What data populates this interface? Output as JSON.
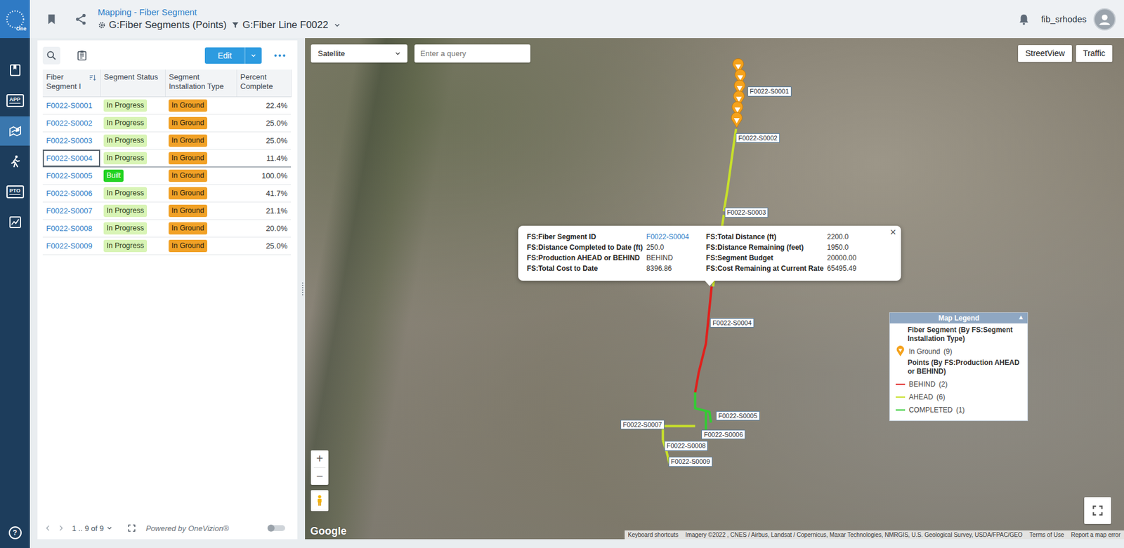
{
  "app": {
    "logo": "One",
    "help": "?"
  },
  "nav": [
    {
      "kind": "book",
      "label": "",
      "selected": false
    },
    {
      "kind": "badge",
      "label": "APP",
      "selected": false
    },
    {
      "kind": "route",
      "label": "",
      "selected": true
    },
    {
      "kind": "walker",
      "label": "",
      "selected": false
    },
    {
      "kind": "badge",
      "label": "PTO",
      "selected": false
    },
    {
      "kind": "chart",
      "label": "",
      "selected": false
    }
  ],
  "header": {
    "title": "Mapping - Fiber Segment",
    "view": "G:Fiber Segments (Points)",
    "filter": "G:Fiber Line F0022",
    "user": "fib_srhodes"
  },
  "toolbar": {
    "edit": "Edit"
  },
  "table": {
    "columns": [
      "Fiber Segment I",
      "Segment Status",
      "Segment Installation Type",
      "Percent Complete"
    ],
    "rows": [
      {
        "id": "F0022-S0001",
        "status": "In Progress",
        "color": "#d8f4b5",
        "type": "In Ground",
        "percent": "22.4%",
        "selected": false
      },
      {
        "id": "F0022-S0002",
        "status": "In Progress",
        "color": "#d8f4b5",
        "type": "In Ground",
        "percent": "25.0%",
        "selected": false
      },
      {
        "id": "F0022-S0003",
        "status": "In Progress",
        "color": "#d8f4b5",
        "type": "In Ground",
        "percent": "25.0%",
        "selected": false
      },
      {
        "id": "F0022-S0004",
        "status": "In Progress",
        "color": "#d8f4b5",
        "type": "In Ground",
        "percent": "11.4%",
        "selected": true
      },
      {
        "id": "F0022-S0005",
        "status": "Built",
        "color": "#22d322",
        "type": "In Ground",
        "percent": "100.0%",
        "selected": false
      },
      {
        "id": "F0022-S0006",
        "status": "In Progress",
        "color": "#d8f4b5",
        "type": "In Ground",
        "percent": "41.7%",
        "selected": false
      },
      {
        "id": "F0022-S0007",
        "status": "In Progress",
        "color": "#d8f4b5",
        "type": "In Ground",
        "percent": "21.1%",
        "selected": false
      },
      {
        "id": "F0022-S0008",
        "status": "In Progress",
        "color": "#d8f4b5",
        "type": "In Ground",
        "percent": "20.0%",
        "selected": false
      },
      {
        "id": "F0022-S0009",
        "status": "In Progress",
        "color": "#d8f4b5",
        "type": "In Ground",
        "percent": "25.0%",
        "selected": false
      }
    ]
  },
  "footer": {
    "range": "1 .. 9 of 9",
    "powered": "Powered by OneVizion®"
  },
  "map": {
    "type": "Satellite",
    "query_placeholder": "Enter a query",
    "buttons": [
      "StreetView",
      "Traffic"
    ],
    "zoom_in": "+",
    "zoom_out": "−",
    "google": "Google",
    "attribution": [
      "Keyboard shortcuts",
      "Imagery ©2022 , CNES / Airbus, Landsat / Copernicus, Maxar Technologies, NMRGIS, U.S. Geological Survey, USDA/FPAC/GEO",
      "Terms of Use",
      "Report a map error"
    ]
  },
  "segments": [
    {
      "label": "F0022-S0001",
      "kind": "pins",
      "color": "#f5a21c"
    },
    {
      "label": "F0022-S0002",
      "kind": "line",
      "color": "#c8e02a"
    },
    {
      "label": "F0022-S0003",
      "kind": "line",
      "color": "#c8e02a"
    },
    {
      "label": "F0022-S0004",
      "kind": "line",
      "color": "#e0201c"
    },
    {
      "label": "F0022-S0005",
      "kind": "line",
      "color": "#33cc33"
    },
    {
      "label": "F0022-S0006",
      "kind": "line",
      "color": "#33cc33"
    },
    {
      "label": "F0022-S0007",
      "kind": "line",
      "color": "#c8e02a"
    },
    {
      "label": "F0022-S0008",
      "kind": "line",
      "color": "#c8e02a"
    },
    {
      "label": "F0022-S0009",
      "kind": "line",
      "color": "#c8e02a"
    }
  ],
  "popup": {
    "close": "×",
    "fields": [
      {
        "label": "FS:Fiber Segment ID",
        "value": "F0022-S0004",
        "link": true
      },
      {
        "label": "FS:Total Distance (ft)",
        "value": "2200.0",
        "link": false
      },
      {
        "label": "FS:Distance Completed to Date (ft)",
        "value": "250.0",
        "link": false
      },
      {
        "label": "FS:Distance Remaining (feet)",
        "value": "1950.0",
        "link": false
      },
      {
        "label": "FS:Production AHEAD or BEHIND",
        "value": "BEHIND",
        "link": false
      },
      {
        "label": "FS:Segment Budget",
        "value": "20000.00",
        "link": false
      },
      {
        "label": "FS:Total Cost to Date",
        "value": "8396.86",
        "link": false
      },
      {
        "label": "FS:Cost Remaining at Current Rate",
        "value": "65495.49",
        "link": false
      }
    ]
  },
  "legend": {
    "title": "Map Legend",
    "toggle": "▲",
    "groups": [
      {
        "title": "Fiber Segment (By FS:Segment Installation Type)",
        "items": [
          {
            "kind": "pin",
            "label": "In Ground",
            "count": "(9)",
            "color": "#f5a21c"
          }
        ]
      },
      {
        "title": "Points (By FS:Production AHEAD or BEHIND)",
        "items": [
          {
            "kind": "line",
            "label": "BEHIND",
            "count": "(2)",
            "color": "#e0201c"
          },
          {
            "kind": "line",
            "label": "AHEAD",
            "count": "(6)",
            "color": "#c8e02a"
          },
          {
            "kind": "line",
            "label": "COMPLETED",
            "count": "(1)",
            "color": "#33cc33"
          }
        ]
      }
    ]
  }
}
